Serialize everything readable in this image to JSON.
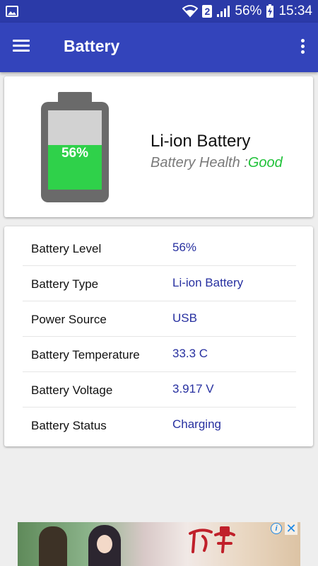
{
  "status_bar": {
    "left_icon": "gallery-icon",
    "wifi_icon": "wifi-icon",
    "sim_badge": "2",
    "signal_icon": "signal-icon",
    "battery_percent": "56%",
    "battery_icon": "battery-charging-icon",
    "time": "15:34"
  },
  "app_bar": {
    "menu_icon": "hamburger-menu-icon",
    "title": "Battery",
    "more_icon": "more-vert-icon"
  },
  "summary": {
    "level_label": "56%",
    "level_fraction": 0.56,
    "name": "Li-ion Battery",
    "health_label": "Battery Health :",
    "health_value": "Good",
    "colors": {
      "fill": "#2fd14a",
      "health_good": "#21c23a"
    }
  },
  "details": [
    {
      "label": "Battery Level",
      "value": "56%"
    },
    {
      "label": "Battery Type",
      "value": "Li-ion Battery"
    },
    {
      "label": "Power Source",
      "value": "USB"
    },
    {
      "label": "Battery Temperature",
      "value": "33.3 C"
    },
    {
      "label": "Battery Voltage",
      "value": "3.917 V"
    },
    {
      "label": "Battery Status",
      "value": "Charging"
    }
  ],
  "ad": {
    "info_icon": "ad-info-icon",
    "close_icon": "close-icon"
  },
  "colors": {
    "status_bar": "#2b3aa8",
    "app_bar": "#3344bb",
    "value_text": "#2730a0"
  }
}
